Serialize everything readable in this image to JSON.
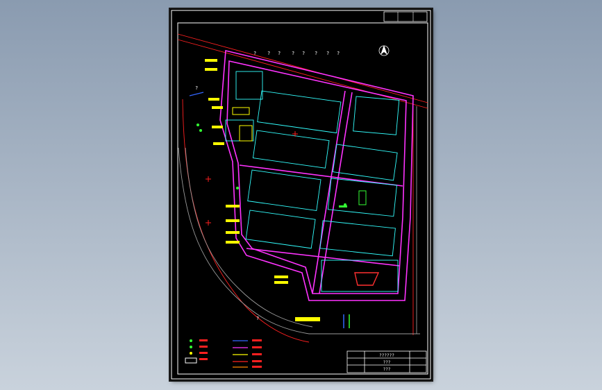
{
  "drawing": {
    "unreadable_marks": [
      "?",
      "?",
      "?",
      "?",
      "?",
      "?",
      "?",
      "?",
      "?",
      "?"
    ],
    "title_block": {
      "main_title": "??????",
      "sub_title": "???",
      "sheet_no": "???"
    },
    "colors": {
      "background": "#000000",
      "frame": "#ffffff",
      "boundary": "#ff2020",
      "roads": "#ff33ff",
      "buildings": "#33ffff",
      "labels": "#ffff00",
      "greenery": "#33ff33",
      "pipes": "#3366ff"
    }
  }
}
